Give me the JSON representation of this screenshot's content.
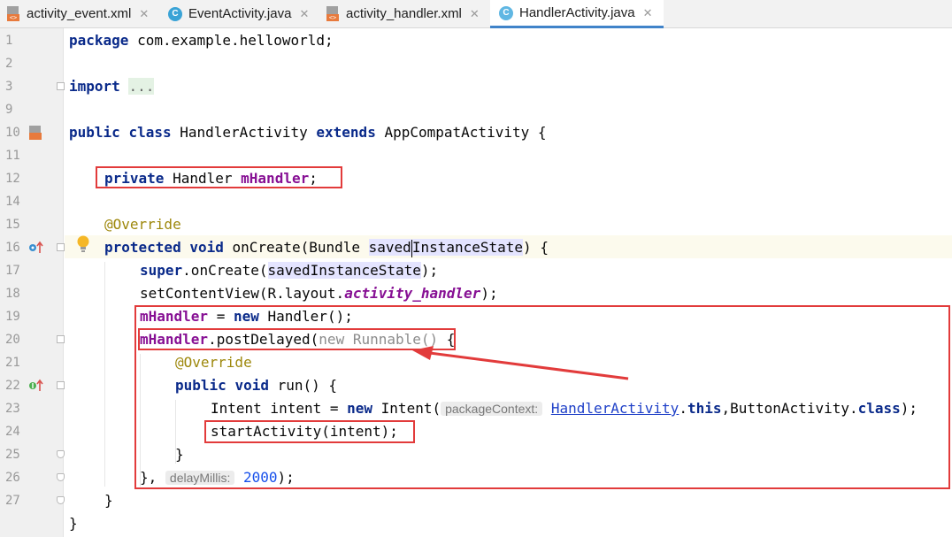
{
  "tabs": [
    {
      "label": "activity_event.xml",
      "icon": "xml-file-icon",
      "active": false
    },
    {
      "label": "EventActivity.java",
      "icon": "java-class-icon",
      "active": false
    },
    {
      "label": "activity_handler.xml",
      "icon": "xml-file-icon",
      "active": false
    },
    {
      "label": "HandlerActivity.java",
      "icon": "java-class-icon",
      "active": true
    }
  ],
  "close_glyph": "✕",
  "xml_icon_text": "<>",
  "class_icon_text": "C",
  "line_numbers": [
    "1",
    "2",
    "3",
    "9",
    "10",
    "11",
    "12",
    "14",
    "15",
    "16",
    "17",
    "18",
    "19",
    "20",
    "21",
    "22",
    "23",
    "24",
    "25",
    "26",
    "27"
  ],
  "code": {
    "l1": {
      "kw": "package",
      "rest": " com.example.helloworld;"
    },
    "l3": {
      "kw": "import",
      "fold": "..."
    },
    "l10": {
      "kw1": "public",
      "kw2": "class",
      "name": "HandlerActivity",
      "kw3": "extends",
      "rest": "AppCompatActivity {"
    },
    "l12": {
      "kw": "private",
      "type": "Handler",
      "field": "mHandler",
      "end": ";"
    },
    "l14": {
      "anno": "@Override"
    },
    "l15": {
      "kw1": "protected",
      "kw2": "void",
      "name": "onCreate(Bundle ",
      "param_a": "saved",
      "param_b": "InstanceState",
      "end": ") {"
    },
    "l16": {
      "kw": "super",
      "mid": ".onCreate(",
      "param": "savedInstanceState",
      "end": ");"
    },
    "l17": {
      "pre": "setContentView(R.layout.",
      "field": "activity_handler",
      "end": ");"
    },
    "l18": {
      "field": "mHandler",
      "mid": " = ",
      "kw": "new",
      "end": " Handler();"
    },
    "l19": {
      "field": "mHandler",
      "mid": ".postDelayed(",
      "gray": "new Runnable()",
      "end": " {"
    },
    "l20": {
      "anno": "@Override"
    },
    "l21": {
      "kw1": "public",
      "kw2": "void",
      "end": " run() {"
    },
    "l22": {
      "pre": "Intent intent = ",
      "kw": "new",
      "mid": " Intent(",
      "hint": "packageContext:",
      "link": "HandlerActivity",
      "dot": ".",
      "kw2": "this",
      "mid2": ",ButtonActivity.",
      "kw3": "class",
      "end": ");"
    },
    "l23": {
      "text": "startActivity(intent);"
    },
    "l24": {
      "text": "}"
    },
    "l25": {
      "pre": "},",
      "hint": "delayMillis:",
      "num": "2000",
      "end": ");"
    },
    "l26": {
      "text": "}"
    },
    "l27": {
      "text": "}"
    }
  },
  "colors": {
    "keyword": "#0a2a8a",
    "field": "#871094",
    "annotation": "#9e880d",
    "number": "#1750eb",
    "highlight_box": "#e23b3b",
    "tab_active_underline": "#4083c9"
  }
}
